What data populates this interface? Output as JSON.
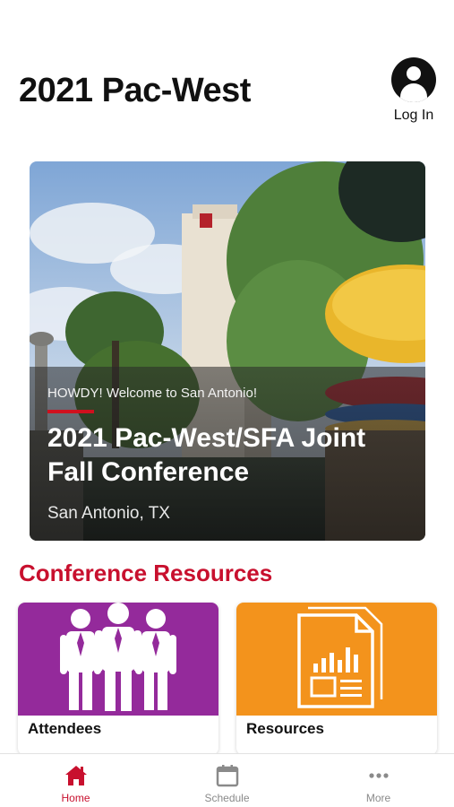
{
  "header": {
    "title": "2021 Pac-West",
    "login_label": "Log In"
  },
  "hero": {
    "tagline": "HOWDY! Welcome to San Antonio!",
    "title": "2021 Pac-West/SFA Joint Fall Conference",
    "location": "San Antonio, TX"
  },
  "resources_section": {
    "title": "Conference Resources",
    "tiles": [
      {
        "label": "Attendees",
        "icon": "people-icon",
        "color": "#942a9b"
      },
      {
        "label": "Resources",
        "icon": "document-chart-icon",
        "color": "#f3931c"
      }
    ]
  },
  "tabbar": {
    "tabs": [
      {
        "label": "Home",
        "icon": "home-icon",
        "active": true
      },
      {
        "label": "Schedule",
        "icon": "calendar-icon",
        "active": false
      },
      {
        "label": "More",
        "icon": "more-dots-icon",
        "active": false
      }
    ]
  },
  "colors": {
    "accent": "#c8102e",
    "attendees_tile": "#942a9b",
    "resources_tile": "#f3931c"
  }
}
